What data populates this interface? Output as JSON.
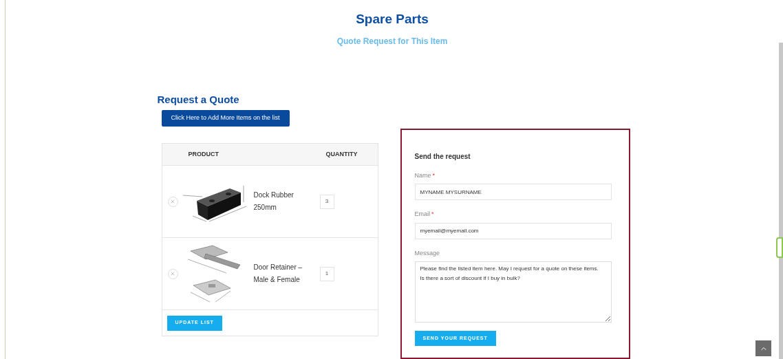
{
  "header": {
    "title": "Spare Parts",
    "subtitle": "Quote Request for This Item"
  },
  "quote": {
    "heading": "Request a Quote",
    "add_button": "Click Here to Add More Items on the list",
    "table": {
      "columns": [
        "PRODUCT",
        "QUANTITY"
      ],
      "rows": [
        {
          "kind": "block",
          "name": "Dock Rubber 250mm",
          "quantity": "3"
        },
        {
          "kind": "bracket",
          "name": "Door Retainer – Male & Female",
          "quantity": "1"
        }
      ],
      "update_button": "UPDATE LIST"
    }
  },
  "form": {
    "title": "Send the request",
    "fields": [
      {
        "kind": "input",
        "label": "Name",
        "required_mark": "*",
        "value": "MYNAME MYSURNAME"
      },
      {
        "kind": "input",
        "label": "Email",
        "required_mark": "*",
        "value": "myemail@myemail.com"
      },
      {
        "kind": "textarea",
        "label": "Message",
        "value": "Please find the listed item here. May I request for a quote on these items.\nIs there a sort of discount if I buy in bulk?"
      }
    ],
    "submit": "SEND YOUR REQUEST"
  }
}
